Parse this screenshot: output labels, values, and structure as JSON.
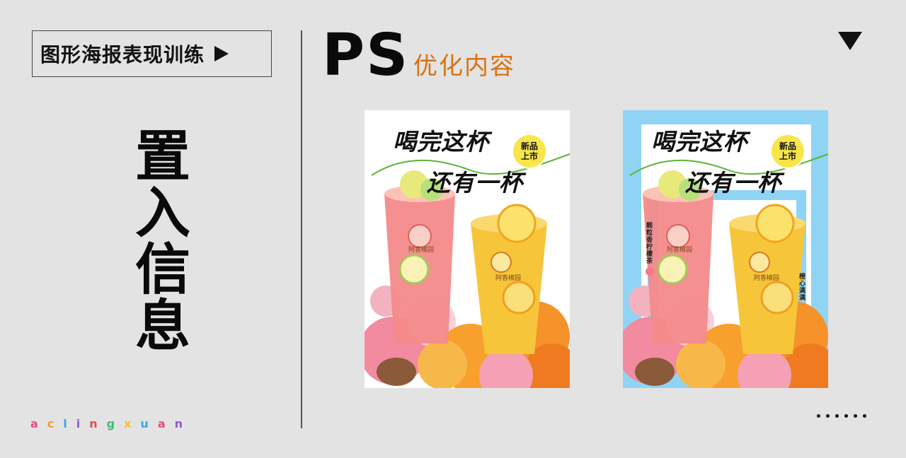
{
  "left_panel": {
    "tag_label": "图形海报表现训练",
    "vertical_title": [
      "置",
      "入",
      "信",
      "息"
    ],
    "brand_letters": [
      {
        "ch": "a",
        "color": "#e84a8a"
      },
      {
        "ch": "c",
        "color": "#f29a2e"
      },
      {
        "ch": "l",
        "color": "#3aa6e0"
      },
      {
        "ch": "i",
        "color": "#8d5ad8"
      },
      {
        "ch": "n",
        "color": "#e84a4a"
      },
      {
        "ch": "g",
        "color": "#3dbf6e"
      },
      {
        "ch": "x",
        "color": "#f2c12e"
      },
      {
        "ch": "u",
        "color": "#3aa6e0"
      },
      {
        "ch": "a",
        "color": "#e84a8a"
      },
      {
        "ch": "n",
        "color": "#8d5ad8"
      }
    ]
  },
  "header": {
    "title": "PS",
    "subtitle": "优化内容",
    "accent_color": "#d87312"
  },
  "posters": {
    "headline_line1": "喝完这杯",
    "headline_line2": "还有一杯",
    "badge_line1": "新品",
    "badge_line2": "上市",
    "cup_brand": "阿香椒园",
    "side_text_left": "颗粒香柠檬茶",
    "side_text_right": "橙心满满"
  },
  "icons": [
    "play-arrow-icon",
    "dropdown-triangle-icon",
    "more-dots-icon"
  ]
}
